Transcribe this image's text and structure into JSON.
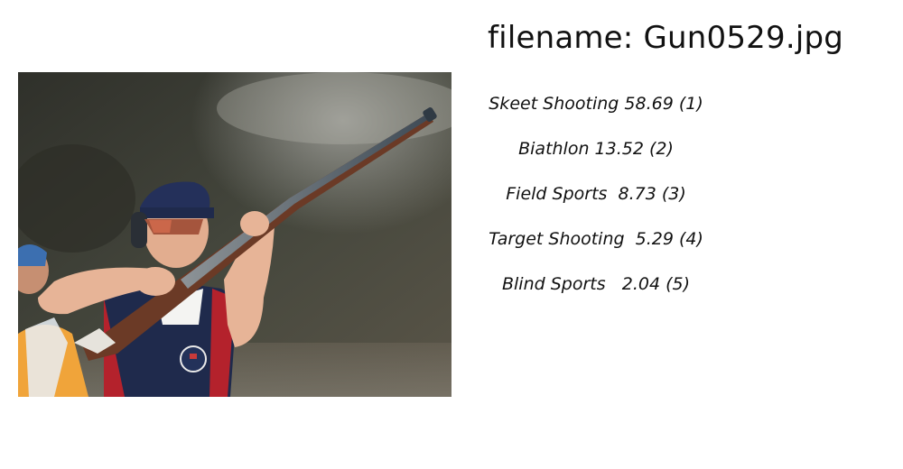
{
  "filename_line": "filename: Gun0529.jpg",
  "photo": {
    "description_icon": "photo-of-shooter-with-shotgun"
  },
  "predictions": [
    {
      "text": "Skeet Shooting 58.69 (1)"
    },
    {
      "text": "Biathlon 13.52 (2)"
    },
    {
      "text": "Field Sports  8.73 (3)"
    },
    {
      "text": "Target Shooting  5.29 (4)"
    },
    {
      "text": "Blind Sports   2.04 (5)"
    }
  ]
}
